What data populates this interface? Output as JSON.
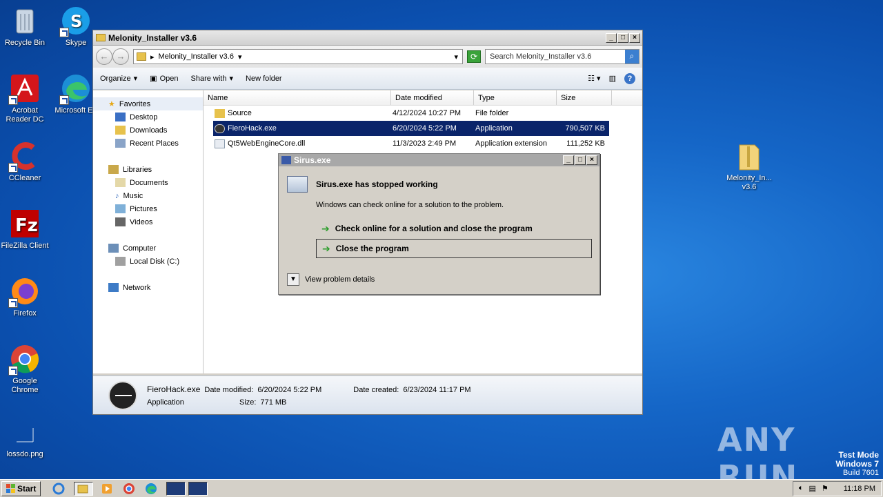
{
  "desktop": {
    "icons": [
      {
        "label": "Recycle Bin"
      },
      {
        "label": "Skype"
      },
      {
        "label": "Acrobat Reader DC"
      },
      {
        "label": "Microsoft Ed"
      },
      {
        "label": "CCleaner"
      },
      {
        "label": "FileZilla Client"
      },
      {
        "label": "Firefox"
      },
      {
        "label": "Google Chrome"
      },
      {
        "label": "lossdo.png"
      },
      {
        "label": "Melonity_In...\nv3.6"
      }
    ]
  },
  "explorer": {
    "title": "Melonity_Installer v3.6",
    "address": "Melonity_Installer v3.6",
    "search_placeholder": "Search Melonity_Installer v3.6",
    "toolbar": {
      "organize": "Organize",
      "open": "Open",
      "share_with": "Share with",
      "new_folder": "New folder"
    },
    "nav": {
      "favorites": "Favorites",
      "desktop": "Desktop",
      "downloads": "Downloads",
      "recent_places": "Recent Places",
      "libraries": "Libraries",
      "documents": "Documents",
      "music": "Music",
      "pictures": "Pictures",
      "videos": "Videos",
      "computer": "Computer",
      "local_disk": "Local Disk (C:)",
      "network": "Network"
    },
    "columns": {
      "name": "Name",
      "date_modified": "Date modified",
      "type": "Type",
      "size": "Size"
    },
    "files": [
      {
        "name": "Source",
        "date": "4/12/2024 10:27 PM",
        "type": "File folder",
        "size": ""
      },
      {
        "name": "FieroHack.exe",
        "date": "6/20/2024 5:22 PM",
        "type": "Application",
        "size": "790,507 KB"
      },
      {
        "name": "Qt5WebEngineCore.dll",
        "date": "11/3/2023 2:49 PM",
        "type": "Application extension",
        "size": "111,252 KB"
      }
    ],
    "details": {
      "name": "FieroHack.exe",
      "type": "Application",
      "date_modified_label": "Date modified:",
      "date_modified": "6/20/2024 5:22 PM",
      "size_label": "Size:",
      "size": "771 MB",
      "date_created_label": "Date created:",
      "date_created": "6/23/2024 11:17 PM"
    }
  },
  "dialog": {
    "title": "Sirus.exe",
    "heading": "Sirus.exe has stopped working",
    "subtext": "Windows can check online for a solution to the problem.",
    "option_check": "Check online for a solution and close the program",
    "option_close": "Close the program",
    "details": "View problem details"
  },
  "taskbar": {
    "start": "Start",
    "clock": "11:18 PM"
  },
  "watermark": {
    "line1": "Test Mode",
    "line2": "Windows 7",
    "line3": "Build 7601",
    "brand": "ANY RUN"
  }
}
